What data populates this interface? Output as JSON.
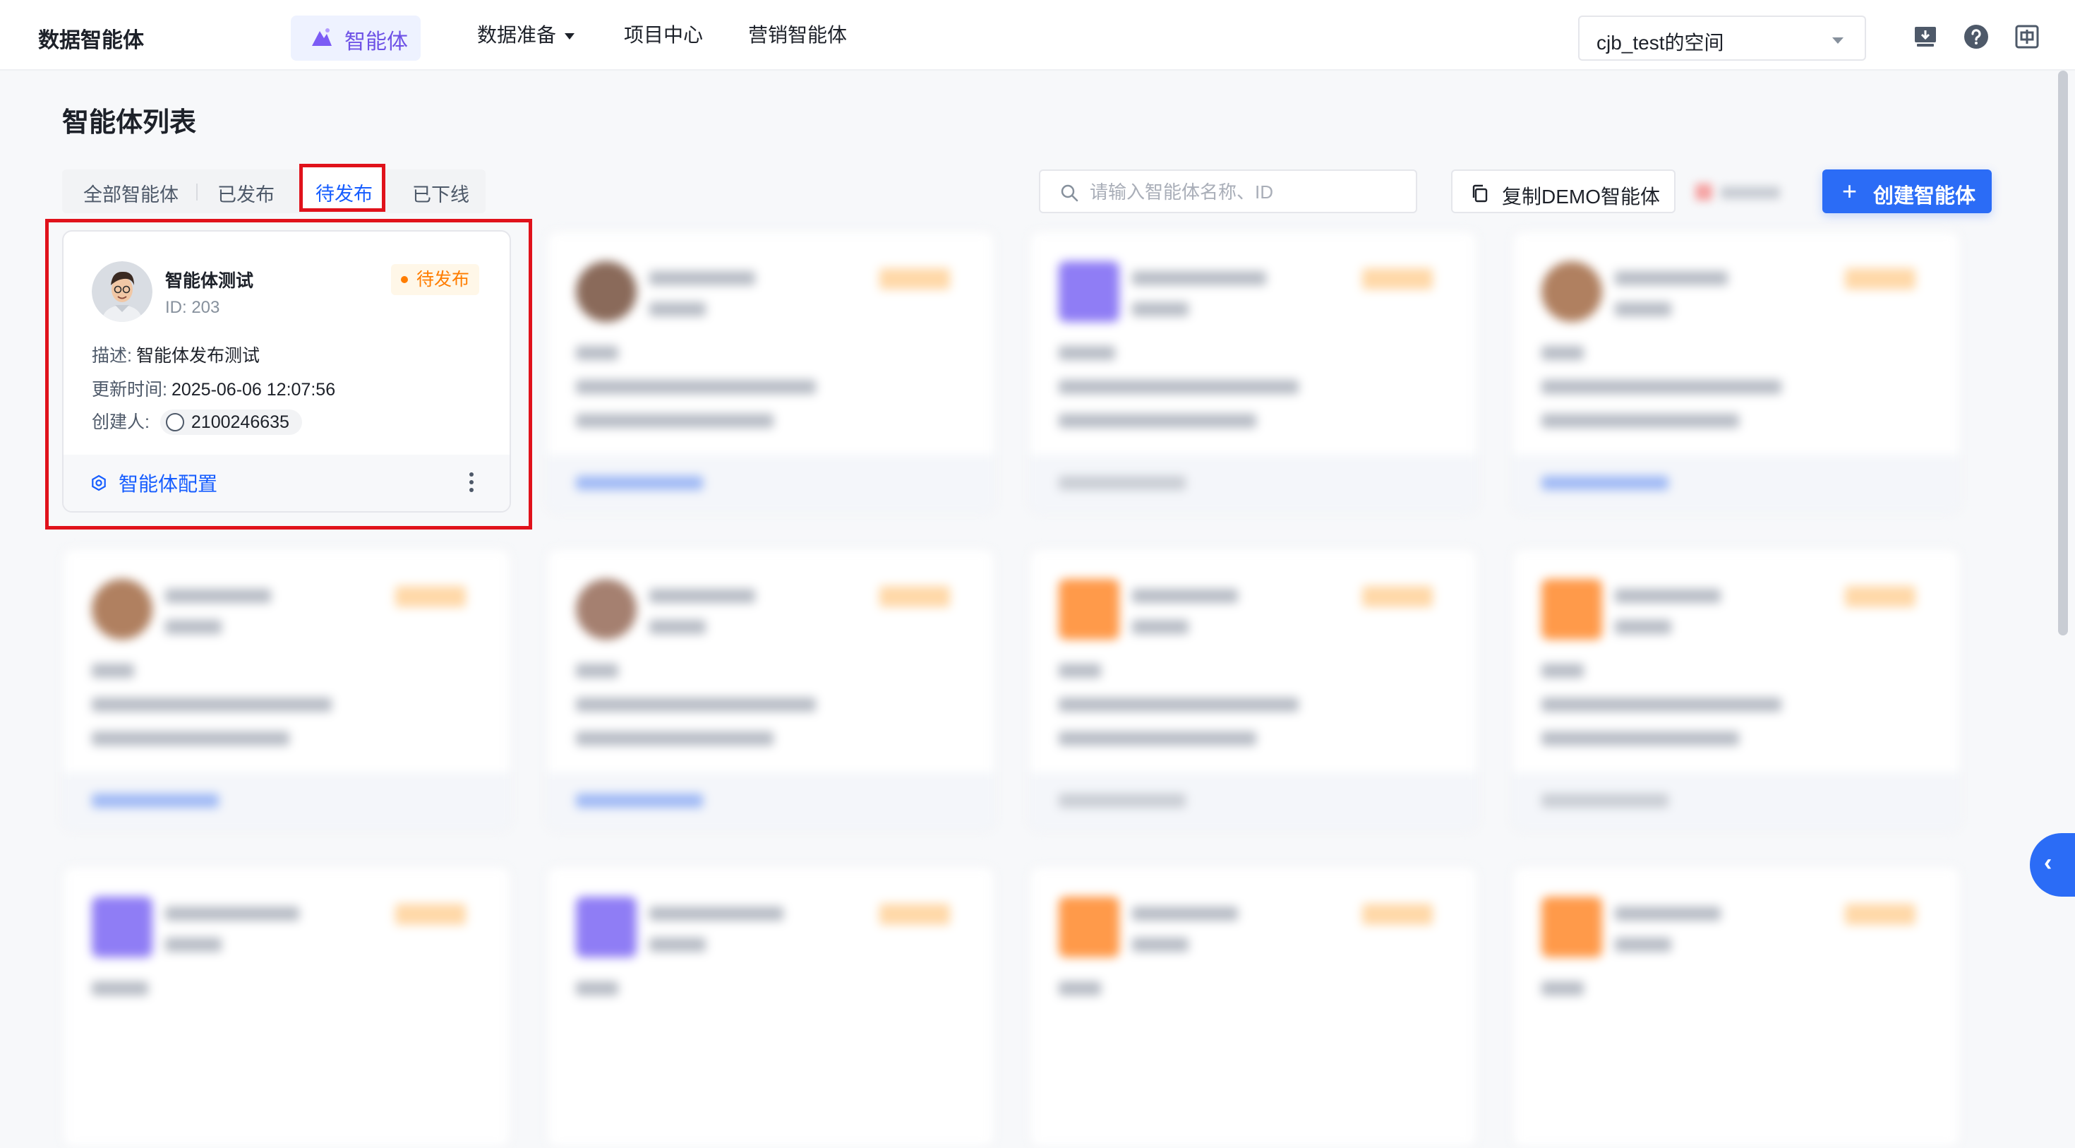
{
  "header": {
    "brand": "数据智能体",
    "nav": {
      "agents": "智能体",
      "data_prep": "数据准备",
      "projects": "项目中心",
      "marketing": "营销智能体"
    },
    "space": "cjb_test的空间"
  },
  "page": {
    "title": "智能体列表"
  },
  "tabs": {
    "all": "全部智能体",
    "published": "已发布",
    "pending": "待发布",
    "offline": "已下线"
  },
  "toolbar": {
    "search_placeholder": "请输入智能体名称、ID",
    "copy_demo": "复制DEMO智能体",
    "create": "创建智能体",
    "create_icon": "+"
  },
  "card": {
    "name": "智能体测试",
    "id_text": "ID: 203",
    "status": "待发布",
    "desc_label": "描述:",
    "desc_value": "智能体发布测试",
    "updated_label": "更新时间:",
    "updated_value": "2025-06-06 12:07:56",
    "creator_label": "创建人:",
    "creator_value": "2100246635",
    "config_link": "智能体配置"
  },
  "side_panel": {
    "toggle_icon": "‹"
  },
  "colors": {
    "primary": "#2b6cf6",
    "link": "#165dff",
    "pending": "#ff7d00",
    "highlight_border": "#e0121b",
    "nav_active_text": "#6e52e6"
  }
}
